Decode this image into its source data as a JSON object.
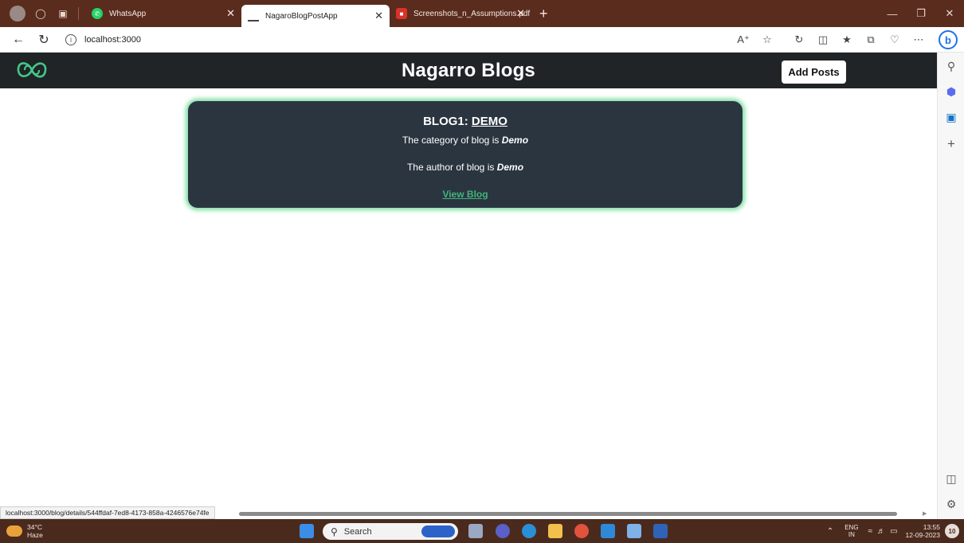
{
  "browser": {
    "tabs": [
      {
        "title": "WhatsApp",
        "active": false
      },
      {
        "title": "NagaroBlogPostApp",
        "active": true
      },
      {
        "title": "Screenshots_n_Assumptions.pdf",
        "active": false
      }
    ],
    "new_tab_icon": "plus-icon",
    "url": "localhost:3000",
    "status_url": "localhost:3000/blog/details/544ffdaf-7ed8-4173-858a-4246576e74fe"
  },
  "app": {
    "title": "Nagarro Blogs",
    "add_posts_label": "Add Posts",
    "accent_color": "#3fb57a",
    "header_color": "#202427"
  },
  "blogs": [
    {
      "label": "BLOG1:",
      "name": "DEMO",
      "category_prefix": "The category of blog is",
      "category": "Demo",
      "author_prefix": "The author of blog is",
      "author": "Demo",
      "view_label": "View Blog"
    }
  ],
  "taskbar": {
    "temperature": "34°C",
    "weather": "Haze",
    "search_placeholder": "Search",
    "lang_top": "ENG",
    "lang_bottom": "IN",
    "time": "13:55",
    "date": "12-09-2023",
    "notification_count": "10"
  }
}
